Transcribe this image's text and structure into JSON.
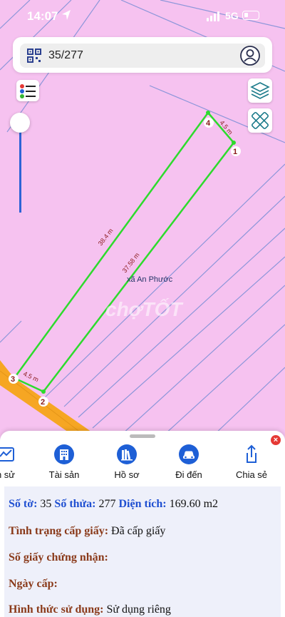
{
  "status": {
    "time": "14:07",
    "network": "5G"
  },
  "search": {
    "value": "35/277"
  },
  "map": {
    "place_label": "xã An Phước",
    "watermark": "chợTỐT",
    "corner_labels": [
      "1",
      "2",
      "3",
      "4"
    ],
    "edge_labels": {
      "top": "4.5 m",
      "bottom": "4.5 m",
      "left": "38.4 m",
      "right": "37.58 m"
    },
    "colors": {
      "parcel_outline": "#2ddb2d",
      "road": "#f6a623",
      "background": "#f6c2f0",
      "lines": "#7a8fd6"
    }
  },
  "tabs": [
    {
      "label": "n sử",
      "icon": "history-chart-icon"
    },
    {
      "label": "Tài sản",
      "icon": "building-icon"
    },
    {
      "label": "Hồ sơ",
      "icon": "books-icon"
    },
    {
      "label": "Đi đến",
      "icon": "car-icon"
    },
    {
      "label": "Chia sẻ",
      "icon": "share-icon"
    }
  ],
  "info": {
    "so_to_label": "Số tờ:",
    "so_to_value": "35",
    "so_thua_label": "Số thửa:",
    "so_thua_value": "277",
    "dien_tich_label": "Diện tích:",
    "dien_tich_value": "169.60 m2",
    "tinh_trang_label": "Tình trạng cấp giấy:",
    "tinh_trang_value": "Đã cấp giấy",
    "so_giay_label": "Số giấy chứng nhận:",
    "ngay_cap_label": "Ngày cấp:",
    "hinh_thuc_label": "Hình thức sử dụng:",
    "hinh_thuc_value": "Sử dụng riêng"
  },
  "close_symbol": "×"
}
